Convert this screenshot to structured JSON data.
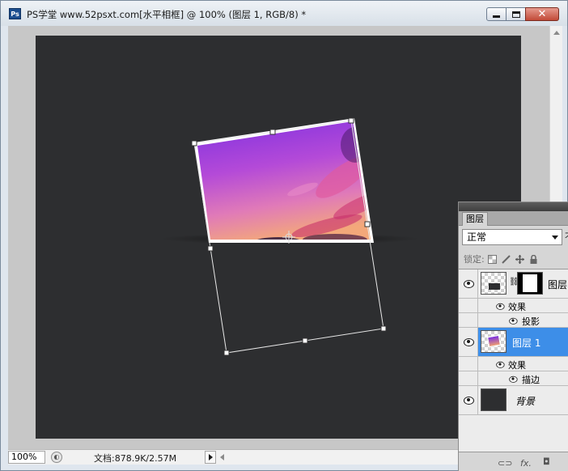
{
  "window": {
    "app_icon": "Ps",
    "title": "PS学堂 www.52psxt.com[水平相框] @ 100% (图层 1, RGB/8) *",
    "buttons": {
      "minimize_icon": "minimize-icon",
      "maximize_icon": "maximize-icon",
      "close_icon": "close-icon"
    }
  },
  "status": {
    "zoom": "100%",
    "doc_info": "文档:878.9K/2.57M"
  },
  "layers_panel": {
    "tab_label": "图层",
    "blend_mode": "正常",
    "blend_extra": "不",
    "lock_label": "锁定:",
    "lock_icons": [
      "lock-transparent-icon",
      "lock-paint-icon",
      "lock-move-icon",
      "lock-all-icon"
    ],
    "layers": [
      {
        "name": "图层",
        "selected": false,
        "effects_label": "效果",
        "effects": [
          "投影"
        ]
      },
      {
        "name": "图层 1",
        "selected": true,
        "effects_label": "效果",
        "effects": [
          "描边"
        ]
      },
      {
        "name": "背景",
        "selected": false
      }
    ],
    "footer_icons": [
      "link-icon",
      "fx-icon",
      "mask-icon"
    ]
  },
  "colors": {
    "canvas": "#2d2e30",
    "selection": "#3d8ee8",
    "sky_top": "#7a2ee0",
    "sky_bottom": "#f0a070"
  }
}
